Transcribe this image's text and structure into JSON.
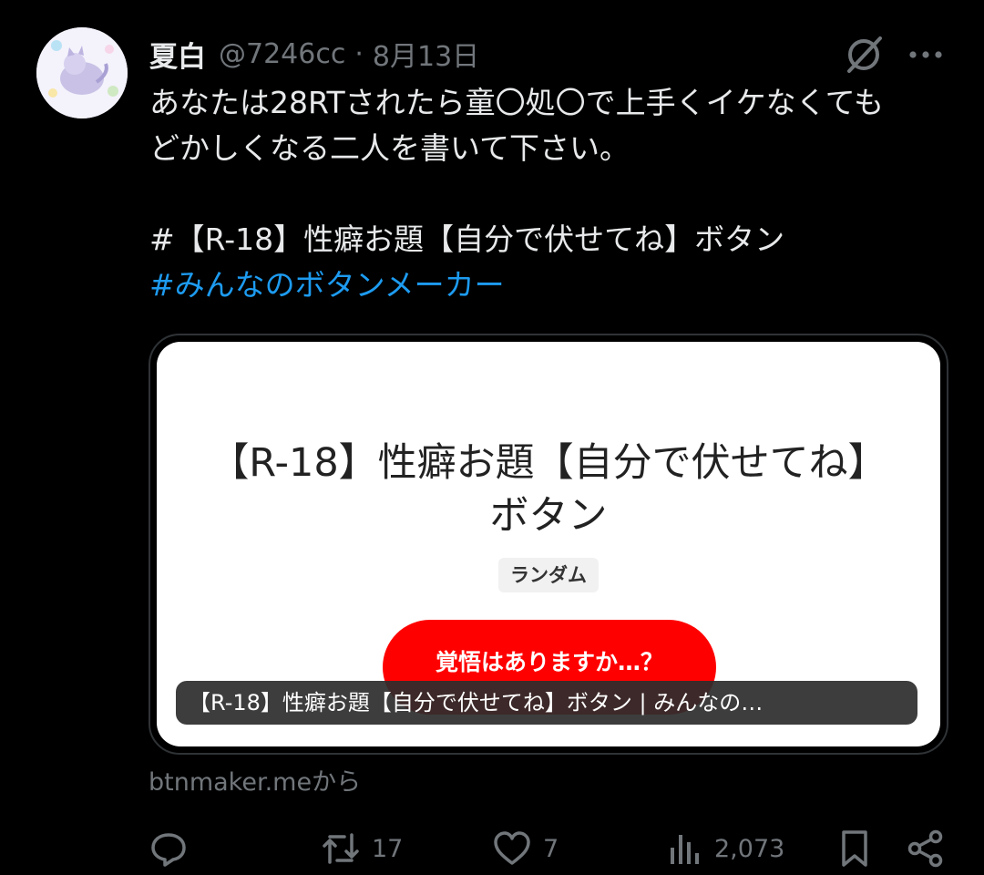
{
  "tweet": {
    "author_name": "夏白",
    "handle": "@7246cc",
    "separator": "·",
    "date": "8月13日",
    "text_lines": [
      "あなたは28RTされたら童〇処〇で上手くイケなくても",
      "どかしくなる二人を書いて下さい。"
    ],
    "hashtag_line_1": "#【R-18】性癖お題【自分で伏せてね】ボタン",
    "hashtag_line_2": "#みんなのボタンメーカー"
  },
  "link_card": {
    "title_line_1": "【R-18】性癖お題【自分で伏せてね】",
    "title_line_2": "ボタン",
    "tag": "ランダム",
    "button_label": "覚悟はありますか…？",
    "caption": "【R-18】性癖お題【自分で伏せてね】ボタン | みんなの…",
    "source": "btnmaker.meから"
  },
  "actions": {
    "reply_count": "",
    "retweet_count": "17",
    "like_count": "7",
    "views_count": "2,073"
  },
  "icons": [
    "grok-icon",
    "more-icon",
    "reply-icon",
    "retweet-icon",
    "like-icon",
    "views-icon",
    "bookmark-icon",
    "share-icon"
  ],
  "colors": {
    "background": "#000000",
    "text": "#e7e9ea",
    "muted": "#71767b",
    "link": "#1d9bf0",
    "button_red": "#ff0000"
  }
}
